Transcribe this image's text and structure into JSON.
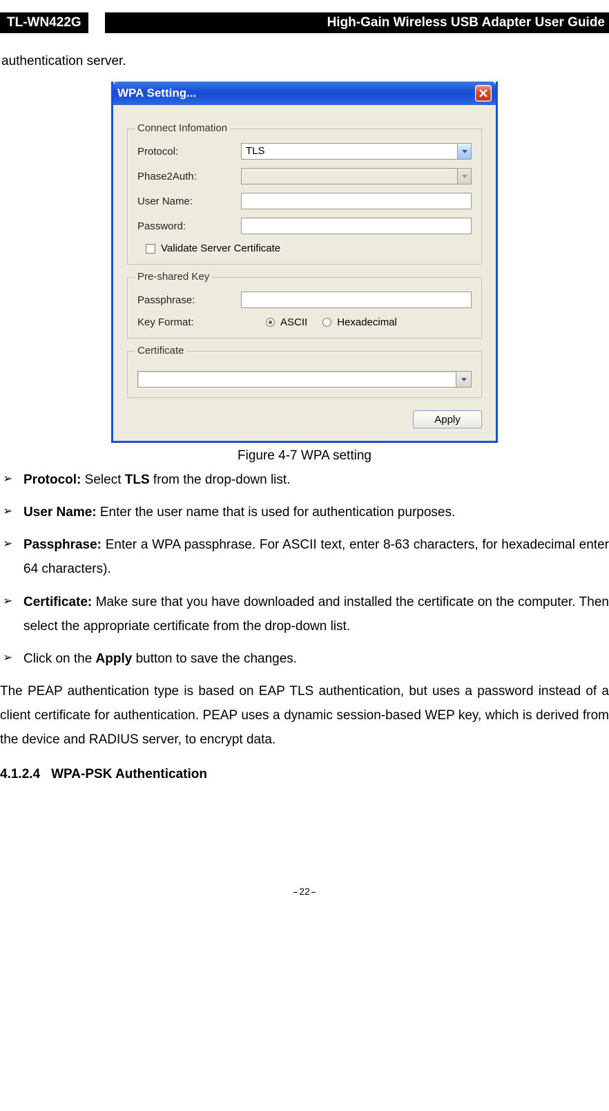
{
  "header": {
    "model": "TL-WN422G",
    "title": "High-Gain Wireless USB Adapter User Guide"
  },
  "intro": "authentication server.",
  "dialog": {
    "title": "WPA Setting...",
    "group1": {
      "legend": "Connect Infomation",
      "protocol_label": "Protocol:",
      "protocol_value": "TLS",
      "phase2_label": "Phase2Auth:",
      "user_label": "User Name:",
      "pass_label": "Password:",
      "validate_label": "Validate Server Certificate"
    },
    "group2": {
      "legend": "Pre-shared Key",
      "passphrase_label": "Passphrase:",
      "keyformat_label": "Key Format:",
      "radio_ascii": "ASCII",
      "radio_hex": "Hexadecimal"
    },
    "group3": {
      "legend": "Certificate"
    },
    "apply": "Apply"
  },
  "caption": "Figure 4-7 WPA setting",
  "bullets": [
    {
      "bold": "Protocol:",
      "text": " Select ",
      "bold2": "TLS",
      "tail": " from the drop-down list."
    },
    {
      "bold": "User Name:",
      "text": " Enter the user name that is used for authentication purposes."
    },
    {
      "bold": "Passphrase:",
      "text": " Enter a WPA passphrase. For ASCII text, enter 8-63 characters, for hexadecimal enter 64 characters)."
    },
    {
      "bold": "Certificate:",
      "text": " Make sure that you have downloaded and installed the certificate on the computer. Then select the appropriate certificate from the drop-down list."
    },
    {
      "plain_pre": "Click on the ",
      "bold": "Apply",
      "plain_post": " button to save the changes."
    }
  ],
  "para": "The PEAP authentication type is based on EAP TLS authentication, but uses a password instead of a client certificate for authentication. PEAP uses a dynamic session-based WEP key, which is derived from the device and RADIUS server, to encrypt data.",
  "section": {
    "num": "4.1.2.4",
    "title": "WPA-PSK Authentication"
  },
  "page_num": "22"
}
